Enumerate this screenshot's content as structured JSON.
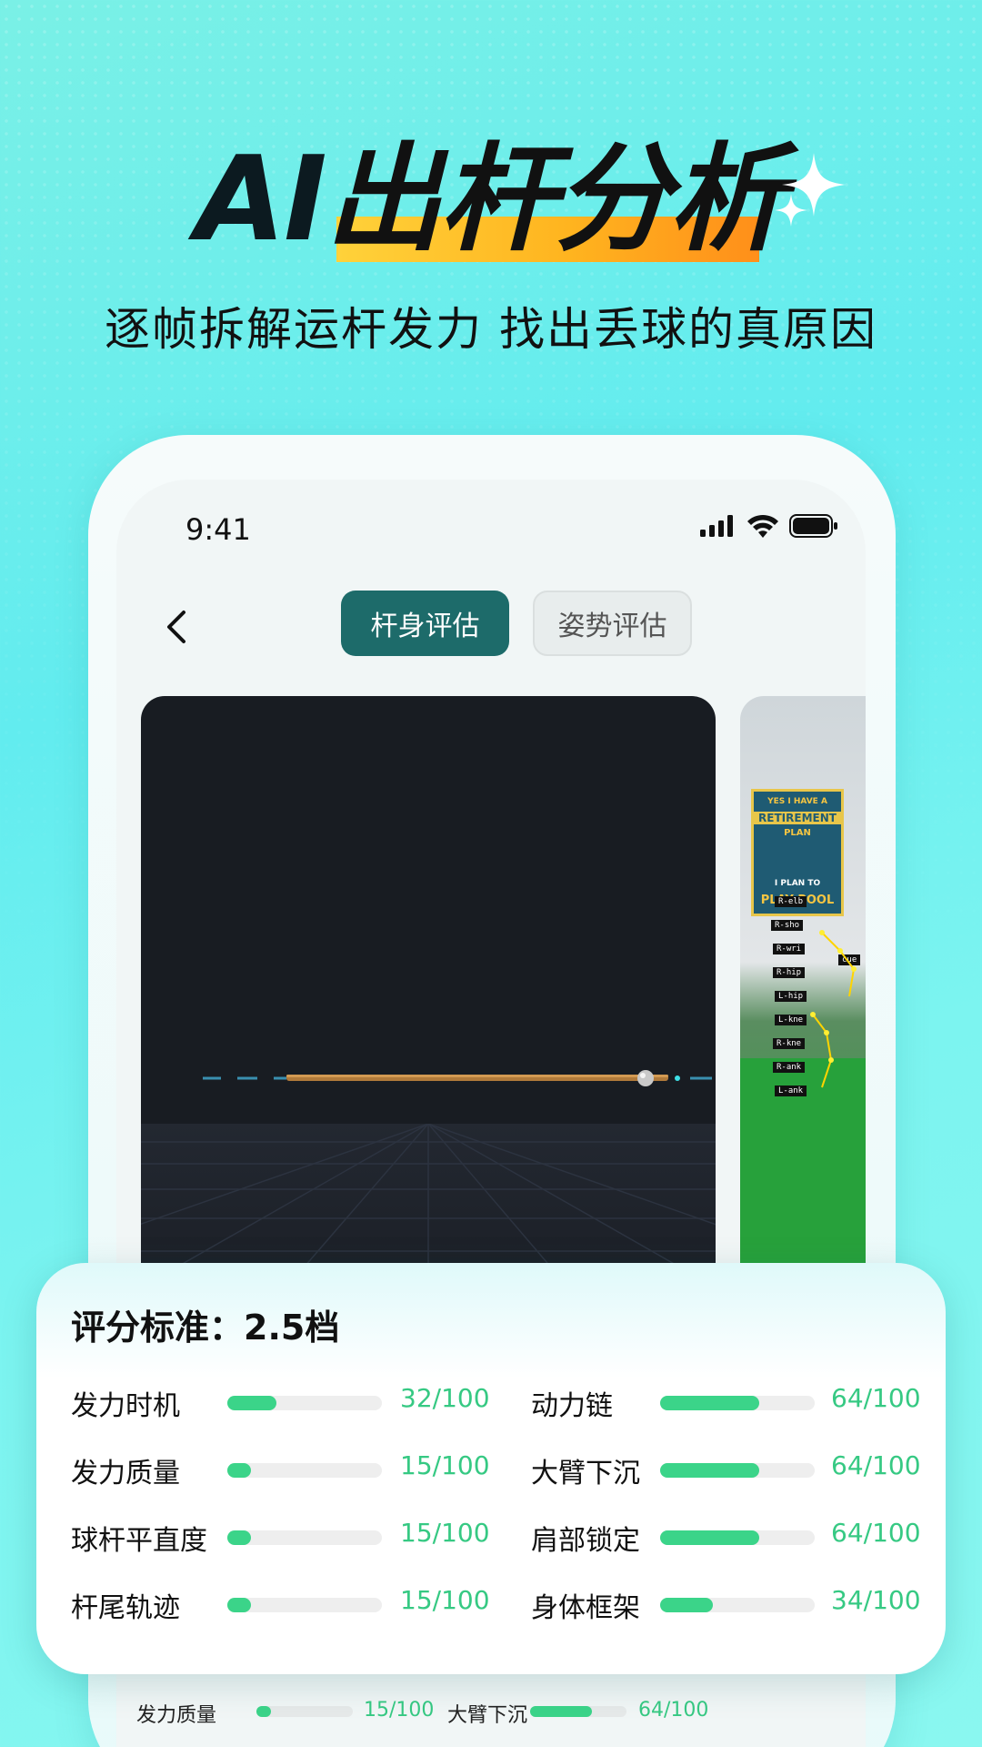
{
  "hero": {
    "title_ai": "AI",
    "title_rest": "出杆分析",
    "subtitle": "逐帧拆解运杆发力 找出丢球的真原因"
  },
  "status": {
    "time": "9:41"
  },
  "tabs": [
    {
      "label": "杆身评估",
      "active": true
    },
    {
      "label": "姿势评估",
      "active": false
    }
  ],
  "photo": {
    "poster_lines": [
      "YES I HAVE A",
      "RETIREMENT",
      "PLAN",
      "I PLAN TO",
      "PLAY POOL"
    ],
    "pose_labels": [
      "R-elb",
      "R-sho",
      "R-wri",
      "R-hip",
      "L-hip",
      "L-kne",
      "R-kne",
      "R-ank",
      "L-ank",
      "cue"
    ]
  },
  "card": {
    "title": "评分标准：2.5档",
    "metrics": [
      {
        "label": "发力时机",
        "value": "32/100",
        "score": 32
      },
      {
        "label": "动力链",
        "value": "64/100",
        "score": 64
      },
      {
        "label": "发力质量",
        "value": "15/100",
        "score": 15
      },
      {
        "label": "大臂下沉",
        "value": "64/100",
        "score": 64
      },
      {
        "label": "球杆平直度",
        "value": "15/100",
        "score": 15
      },
      {
        "label": "肩部锁定",
        "value": "64/100",
        "score": 64
      },
      {
        "label": "杆尾轨迹",
        "value": "15/100",
        "score": 15
      },
      {
        "label": "身体框架",
        "value": "34/100",
        "score": 34
      }
    ]
  },
  "behind_row": [
    {
      "label": "发力质量",
      "value": "15/100",
      "score": 15
    },
    {
      "label": "大臂下沉",
      "value": "64/100",
      "score": 64
    }
  ],
  "colors": {
    "accent": "#1d6b6a",
    "bar": "#3bd489",
    "value": "#36c983"
  }
}
